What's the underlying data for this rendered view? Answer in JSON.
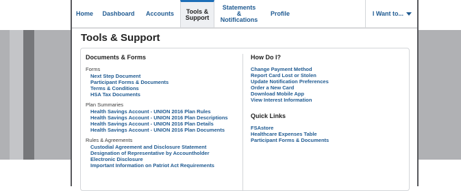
{
  "nav": {
    "items": [
      {
        "label": "Home",
        "active": false
      },
      {
        "label": "Dashboard",
        "active": false
      },
      {
        "label": "Accounts",
        "active": false
      },
      {
        "label": "Tools & Support",
        "active": true
      },
      {
        "label": "Statements & Notifications",
        "active": false
      },
      {
        "label": "Profile",
        "active": false
      }
    ],
    "iwant": "I Want to..."
  },
  "page": {
    "title": "Tools & Support"
  },
  "documents": {
    "title": "Documents & Forms",
    "groups": [
      {
        "title": "Forms",
        "links": [
          "Next Step Document",
          "Participant Forms & Documents",
          "Terms & Conditions",
          "HSA Tax Documents"
        ]
      },
      {
        "title": "Plan Summaries",
        "links": [
          "Health Savings Account - UNION 2016 Plan Rules",
          "Health Savings Account - UNION 2016 Plan Descriptions",
          "Health Savings Account - UNION 2016 Plan Details",
          "Health Savings Account - UNION 2016 Plan Documents"
        ]
      },
      {
        "title": "Rules & Agreements",
        "links": [
          "Custodial Agreement and Disclosure Statement",
          "Designation of Representative by Accountholder",
          "Electronic Disclosure",
          "Important Information on Patriot Act Requirements"
        ]
      }
    ]
  },
  "howdoi": {
    "title": "How Do I?",
    "links": [
      "Change Payment Method",
      "Report Card Lost or Stolen",
      "Update Notification Preferences",
      "Order a New Card",
      "Download Mobile App",
      "View Interest Information"
    ]
  },
  "quicklinks": {
    "title": "Quick Links",
    "links": [
      "FSAstore",
      "Healthcare Expenses Table",
      "Participant Forms & Documents"
    ]
  },
  "colors": {
    "link": "#1f5a91",
    "active_tab_border": "#1d6fb8",
    "background_band": "#b0b1b4"
  }
}
